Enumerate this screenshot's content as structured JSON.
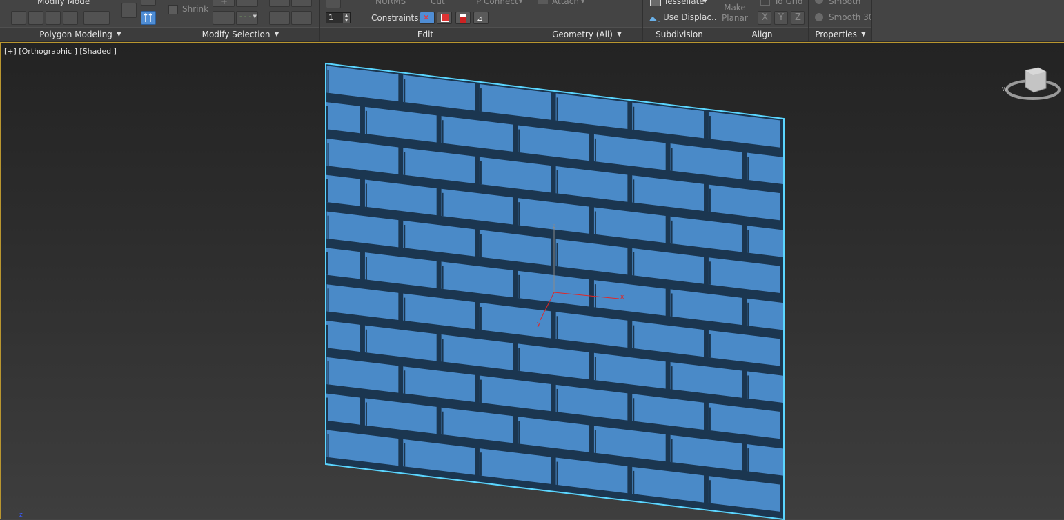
{
  "ribbon": {
    "panels": [
      {
        "id": "polygon-modeling",
        "label": "Polygon Modeling"
      },
      {
        "id": "modify-selection",
        "label": "Modify Selection"
      },
      {
        "id": "edit",
        "label": "Edit"
      },
      {
        "id": "geometry-all",
        "label": "Geometry (All)"
      },
      {
        "id": "subdivision",
        "label": "Subdivision"
      },
      {
        "id": "align",
        "label": "Align"
      },
      {
        "id": "properties",
        "label": "Properties"
      }
    ],
    "polygon_modeling": {
      "modify_mode_label": "Modify Mode"
    },
    "modify_selection": {
      "shrink_label": "Shrink"
    },
    "edit": {
      "nurms_label": "NURMS",
      "cut_label": "Cut",
      "p_connect_label": "P Connect",
      "spinner_value": "1",
      "constraints_label": "Constraints:"
    },
    "geometry": {
      "attach_label": "Attach"
    },
    "subdivision": {
      "tessellate_label": "Tessellate",
      "use_displace_label": "Use Displac..."
    },
    "align": {
      "make_planar_label": "Make\nPlanar",
      "to_grid_label": "To Grid",
      "x": "X",
      "y": "Y",
      "z": "Z"
    },
    "properties": {
      "smooth_label": "Smooth",
      "smooth30_label": "Smooth 30"
    }
  },
  "viewport": {
    "label": "[+] [Orthographic ] [Shaded ]",
    "gizmo": {
      "x_label": "x",
      "y_label": "y",
      "z_label": "z"
    },
    "axis_corner_label": "z",
    "colors": {
      "brick_face": "#4a8ac8",
      "mortar_shadow": "#1b3650",
      "selection_outline": "#5bd6ff",
      "active_border": "#b9962f"
    },
    "brick_wall": {
      "rows": 11,
      "bricks_per_row": 6
    }
  }
}
